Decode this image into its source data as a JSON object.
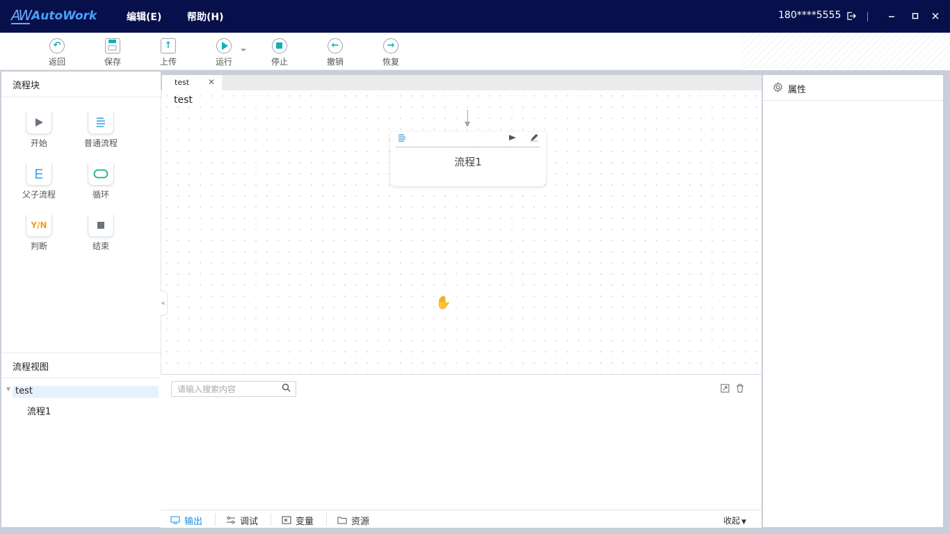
{
  "app": {
    "logo_mark": "AW",
    "logo_name": "AutoWork"
  },
  "menu": {
    "edit": "编辑(E)",
    "help": "帮助(H)"
  },
  "user": {
    "phone": "180****5555"
  },
  "toolbar": {
    "back": "返回",
    "save": "保存",
    "upload": "上传",
    "run": "运行",
    "stop": "停止",
    "undo": "撤销",
    "redo": "恢复"
  },
  "left": {
    "blocks_title": "流程块",
    "blocks": [
      {
        "label": "开始",
        "icon": "play-icon"
      },
      {
        "label": "普通流程",
        "icon": "list-icon"
      },
      {
        "label": "父子流程",
        "icon": "tree-icon"
      },
      {
        "label": "循环",
        "icon": "loop-icon"
      },
      {
        "label": "判断",
        "icon": "yn-icon",
        "glyph": "Y/N"
      },
      {
        "label": "结束",
        "icon": "stop-icon"
      }
    ],
    "view_title": "流程视图",
    "tree": {
      "root": "test",
      "child": "流程1"
    }
  },
  "editor": {
    "tab_label": "test",
    "canvas_title": "test",
    "node_label": "流程1"
  },
  "output": {
    "search_placeholder": "请输入搜索内容",
    "tabs": [
      "输出",
      "调试",
      "变量",
      "资源"
    ],
    "collapse": "收起"
  },
  "properties": {
    "title": "属性"
  },
  "colors": {
    "titlebar": "#07104a",
    "accent": "#10b3b3",
    "active_tab": "#1a8ce0",
    "yn": "#f0a020"
  }
}
